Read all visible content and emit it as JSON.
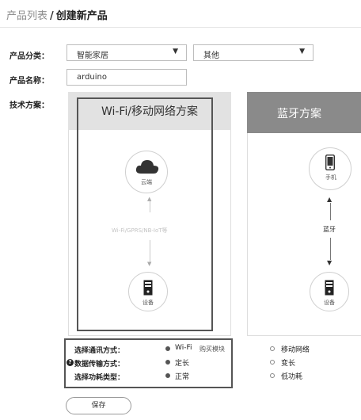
{
  "breadcrumb": {
    "parent": "产品列表",
    "separator": "/",
    "current": "创建新产品"
  },
  "form": {
    "category_label": "产品分类：",
    "category_value": "智能家居",
    "subcategory_value": "其他",
    "name_label": "产品名称：",
    "name_value": "arduino",
    "tech_label": "技术方案："
  },
  "cards": [
    {
      "title": "Wi-Fi/移动网络方案",
      "top_node": "云端",
      "link_text": "Wi-Fi/GPRS/NB-IoT等",
      "bottom_node": "设备"
    },
    {
      "title": "蓝牙方案",
      "top_node": "手机",
      "link_text": "蓝牙",
      "bottom_node": "设备"
    }
  ],
  "options": {
    "comm_label": "选择通讯方式：",
    "data_label": "数据传输方式：",
    "power_label": "选择功耗类型：",
    "comm_a": "Wi-Fi",
    "comm_a_extra": "购买模块",
    "comm_b": "移动网络",
    "data_a": "定长",
    "data_b": "变长",
    "power_a": "正常",
    "power_b": "低功耗"
  },
  "save_label": "保存",
  "help_icon_glyph": "?",
  "icons": [
    "cloud-icon",
    "server-icon",
    "phone-icon",
    "chevron-down-icon",
    "help-icon"
  ]
}
